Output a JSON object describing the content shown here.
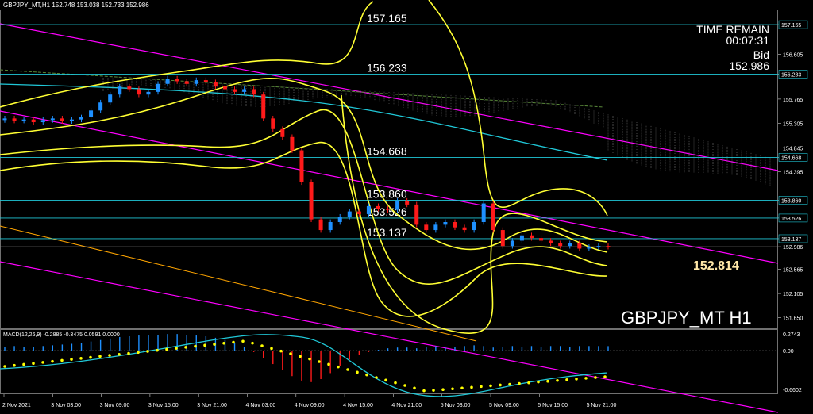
{
  "header": {
    "symbol_ohlc": "GBPJPY_MT,H1  152.748 153.038 152.733 152.986"
  },
  "macd": {
    "label": "MACD(12,26,9) -0.2885 -0.3475 0.0591 0.0000",
    "axis_ticks": [
      "0.2743",
      "0.00",
      "-0.6602"
    ]
  },
  "info": {
    "time_remain_label": "TIME REMAIN",
    "time_remain_value": "00:07:31",
    "bid_label": "Bid",
    "bid_value": "152.986"
  },
  "symbol_label": "GBPJPY_MT H1",
  "highlight_price": "152.814",
  "colors": {
    "background": "#000000",
    "bull": "#1e90ff",
    "bear": "#ff1a1a",
    "bands": "#ffff33",
    "cyan_line": "#20c8d8",
    "channel": "#ff00ff",
    "orange_line": "#ffa500",
    "macd_signal": "#ffff00"
  },
  "chart_data": {
    "type": "candlestick",
    "title": "GBPJPY_MT,H1",
    "y_range": [
      151.45,
      157.45
    ],
    "price_axis_ticks": [
      "157.165",
      "156.605",
      "156.233",
      "155.765",
      "155.305",
      "154.845",
      "154.668",
      "154.395",
      "153.860",
      "153.526",
      "153.137",
      "152.986",
      "152.565",
      "152.105",
      "151.650"
    ],
    "x_axis_labels": [
      "2 Nov 2021",
      "3 Nov 03:00",
      "3 Nov 09:00",
      "3 Nov 15:00",
      "3 Nov 21:00",
      "4 Nov 03:00",
      "4 Nov 09:00",
      "4 Nov 15:00",
      "4 Nov 21:00",
      "5 Nov 03:00",
      "5 Nov 09:00",
      "5 Nov 15:00",
      "5 Nov 21:00"
    ],
    "horizontal_levels": [
      {
        "label": "157.165",
        "value": 157.165
      },
      {
        "label": "156.233",
        "value": 156.233
      },
      {
        "label": "154.668",
        "value": 154.668
      },
      {
        "label": "153.860",
        "value": 153.86
      },
      {
        "label": "153.526",
        "value": 153.526
      },
      {
        "label": "153.137",
        "value": 153.137
      }
    ],
    "current_price": 152.986,
    "candles_close": [
      155.4,
      155.36,
      155.38,
      155.33,
      155.37,
      155.4,
      155.35,
      155.38,
      155.42,
      155.55,
      155.7,
      155.85,
      156.0,
      155.95,
      155.85,
      155.9,
      156.05,
      156.15,
      156.1,
      156.05,
      156.12,
      156.08,
      156.0,
      155.95,
      155.9,
      155.95,
      155.85,
      155.4,
      155.2,
      155.05,
      154.8,
      154.2,
      153.5,
      153.3,
      153.45,
      153.55,
      153.65,
      153.6,
      153.75,
      153.7,
      153.68,
      153.85,
      153.78,
      153.4,
      153.3,
      153.4,
      153.45,
      153.35,
      153.3,
      153.45,
      153.8,
      153.3,
      153.0,
      153.1,
      153.2,
      153.15,
      153.1,
      153.05,
      153.0,
      153.05,
      152.95,
      152.98,
      153.0,
      152.986
    ],
    "macd_histogram": [
      0.05,
      0.06,
      0.05,
      0.05,
      0.06,
      0.07,
      0.08,
      0.09,
      0.1,
      0.12,
      0.14,
      0.16,
      0.18,
      0.19,
      0.2,
      0.2,
      0.21,
      0.22,
      0.22,
      0.21,
      0.2,
      0.19,
      0.17,
      0.14,
      0.1,
      0.05,
      -0.02,
      -0.1,
      -0.18,
      -0.26,
      -0.34,
      -0.4,
      -0.42,
      -0.38,
      -0.3,
      -0.2,
      -0.12,
      -0.06,
      -0.02,
      0.01,
      0.03,
      0.04,
      0.04,
      0.03,
      0.05,
      0.06,
      0.05,
      0.05,
      0.06,
      0.07,
      0.06,
      0.04,
      0.05,
      0.06,
      0.05,
      0.06,
      0.05,
      0.06,
      0.06,
      0.05,
      0.06,
      0.06,
      0.06,
      0.0591
    ]
  }
}
